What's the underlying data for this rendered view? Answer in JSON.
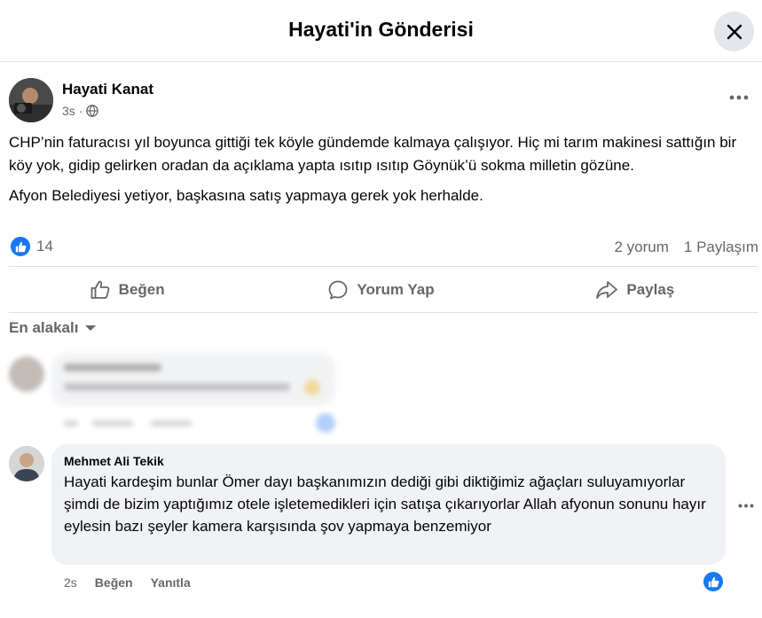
{
  "header": {
    "title": "Hayati'in Gönderisi"
  },
  "post": {
    "author": "Hayati Kanat",
    "time": "3s",
    "privacy_icon": "globe-icon",
    "paragraphs": [
      "CHP’nin faturacısı yıl boyunca gittiği tek köyle gündemde kalmaya çalışıyor. Hiç mi tarım makinesi sattığın bir köy yok, gidip gelirken oradan da açıklama yapta ısıtıp ısıtıp Göynük’ü sokma milletin gözüne.",
      "Afyon Belediyesi yetiyor, başkasına satış yapmaya gerek yok herhalde."
    ],
    "reaction_count": "14",
    "comments_count": "2 yorum",
    "shares_count": "1 Paylaşım"
  },
  "actions": {
    "like": "Beğen",
    "comment": "Yorum Yap",
    "share": "Paylaş"
  },
  "sort_label": "En alakalı",
  "comment": {
    "author": "Mehmet Ali Tekik",
    "text": "Hayati kardeşim bunlar Ömer dayı başkanımızın dediği gibi diktiğimiz ağaçları suluyamıyorlar şimdi de bizim yaptığımız otele işletemedikleri için satışa çıkarıyorlar Allah afyonun sonunu hayır eylesin bazı şeyler kamera karşısında şov yapmaya benzemiyor",
    "time": "2s",
    "like": "Beğen",
    "reply": "Yanıtla"
  },
  "colors": {
    "accent": "#1877f2",
    "muted": "#65676b",
    "bubble": "#f0f2f5"
  }
}
